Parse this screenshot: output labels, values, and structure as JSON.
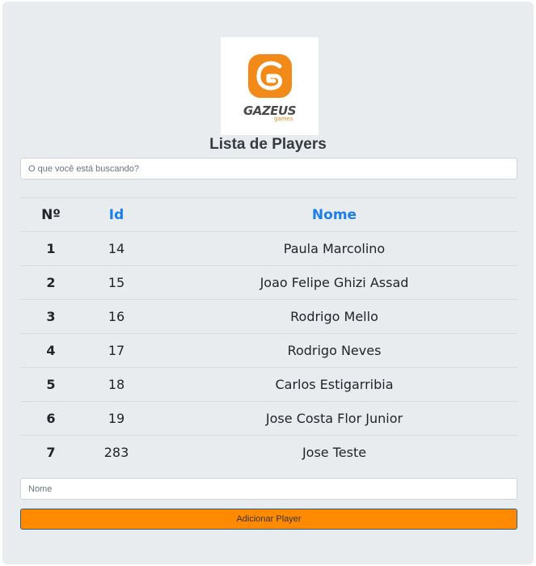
{
  "logo": {
    "brand": "GAZEUS",
    "sub": "games",
    "accent": "#f28a1a"
  },
  "title": "Lista de Players",
  "search": {
    "placeholder": "O que você está buscando?"
  },
  "table": {
    "headers": {
      "number": "Nº",
      "id": "Id",
      "name": "Nome"
    },
    "rows": [
      {
        "number": "1",
        "id": "14",
        "name": "Paula Marcolino"
      },
      {
        "number": "2",
        "id": "15",
        "name": "Joao Felipe Ghizi Assad"
      },
      {
        "number": "3",
        "id": "16",
        "name": "Rodrigo Mello"
      },
      {
        "number": "4",
        "id": "17",
        "name": "Rodrigo Neves"
      },
      {
        "number": "5",
        "id": "18",
        "name": "Carlos Estigarribia"
      },
      {
        "number": "6",
        "id": "19",
        "name": "Jose Costa Flor Junior"
      },
      {
        "number": "7",
        "id": "283",
        "name": "Jose Teste"
      }
    ]
  },
  "form": {
    "name_placeholder": "Nome",
    "add_label": "Adicionar Player",
    "button_color": "#ff8a00"
  }
}
